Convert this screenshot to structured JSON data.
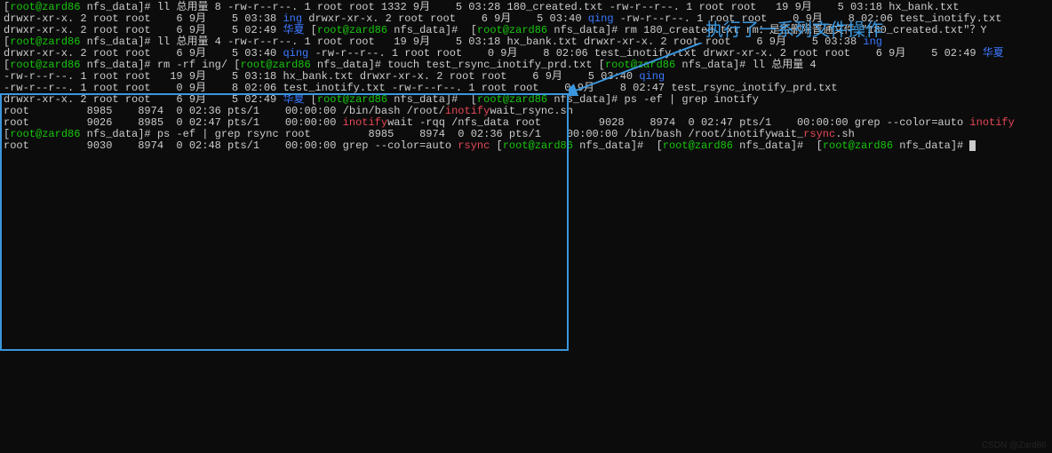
{
  "annotation": "执行了一系列文件操作",
  "watermark": "CSDN @Zard86",
  "prompts": {
    "userhost": "root@zard86",
    "path": "nfs_data"
  },
  "block1": {
    "cmd": "ll",
    "total": "总用量 8",
    "rows": [
      {
        "perm": "-rw-r--r--.",
        "links": "1",
        "owner": "root",
        "group": "root",
        "size": "1332",
        "month": "9月",
        "day": "5",
        "time": "03:28",
        "fname": "180_created.txt",
        "type": "file"
      },
      {
        "perm": "-rw-r--r--.",
        "links": "1",
        "owner": "root",
        "group": "root",
        "size": "19",
        "month": "9月",
        "day": "5",
        "time": "03:18",
        "fname": "hx_bank.txt",
        "type": "file"
      },
      {
        "perm": "drwxr-xr-x.",
        "links": "2",
        "owner": "root",
        "group": "root",
        "size": "6",
        "month": "9月",
        "day": "5",
        "time": "03:38",
        "fname": "ing",
        "type": "dir"
      },
      {
        "perm": "drwxr-xr-x.",
        "links": "2",
        "owner": "root",
        "group": "root",
        "size": "6",
        "month": "9月",
        "day": "5",
        "time": "03:40",
        "fname": "qing",
        "type": "dir"
      },
      {
        "perm": "-rw-r--r--.",
        "links": "1",
        "owner": "root",
        "group": "root",
        "size": "0",
        "month": "9月",
        "day": "8",
        "time": "02:06",
        "fname": "test_inotify.txt",
        "type": "file"
      },
      {
        "perm": "drwxr-xr-x.",
        "links": "2",
        "owner": "root",
        "group": "root",
        "size": "6",
        "month": "9月",
        "day": "5",
        "time": "02:49",
        "fname": "华夏",
        "type": "dir"
      }
    ]
  },
  "block2": {
    "emptycmd": "",
    "rmcmd": "rm 180_created.txt",
    "rmprompt": "rm：是否删除普通文件 \"180_created.txt\"？Y",
    "llcmd": "ll",
    "total": "总用量 4",
    "rows": [
      {
        "perm": "-rw-r--r--.",
        "links": "1",
        "owner": "root",
        "group": "root",
        "size": "19",
        "month": "9月",
        "day": "5",
        "time": "03:18",
        "fname": "hx_bank.txt",
        "type": "file"
      },
      {
        "perm": "drwxr-xr-x.",
        "links": "2",
        "owner": "root",
        "group": "root",
        "size": "6",
        "month": "9月",
        "day": "5",
        "time": "03:38",
        "fname": "ing",
        "type": "dir"
      },
      {
        "perm": "drwxr-xr-x.",
        "links": "2",
        "owner": "root",
        "group": "root",
        "size": "6",
        "month": "9月",
        "day": "5",
        "time": "03:40",
        "fname": "qing",
        "type": "dir"
      },
      {
        "perm": "-rw-r--r--.",
        "links": "1",
        "owner": "root",
        "group": "root",
        "size": "0",
        "month": "9月",
        "day": "8",
        "time": "02:06",
        "fname": "test_inotify.txt",
        "type": "file"
      },
      {
        "perm": "drwxr-xr-x.",
        "links": "2",
        "owner": "root",
        "group": "root",
        "size": "6",
        "month": "9月",
        "day": "5",
        "time": "02:49",
        "fname": "华夏",
        "type": "dir"
      }
    ],
    "rmrf": "rm -rf ing/",
    "touch": "touch test_rsync_inotify_prd.txt",
    "llcmd2": "ll",
    "total2": "总用量 4",
    "rows2": [
      {
        "perm": "-rw-r--r--.",
        "links": "1",
        "owner": "root",
        "group": "root",
        "size": "19",
        "month": "9月",
        "day": "5",
        "time": "03:18",
        "fname": "hx_bank.txt",
        "type": "file"
      },
      {
        "perm": "drwxr-xr-x.",
        "links": "2",
        "owner": "root",
        "group": "root",
        "size": "6",
        "month": "9月",
        "day": "5",
        "time": "03:40",
        "fname": "qing",
        "type": "dir"
      },
      {
        "perm": "-rw-r--r--.",
        "links": "1",
        "owner": "root",
        "group": "root",
        "size": "0",
        "month": "9月",
        "day": "8",
        "time": "02:06",
        "fname": "test_inotify.txt",
        "type": "file"
      },
      {
        "perm": "-rw-r--r--.",
        "links": "1",
        "owner": "root",
        "group": "root",
        "size": "0",
        "month": "9月",
        "day": "8",
        "time": "02:47",
        "fname": "test_rsync_inotify_prd.txt",
        "type": "file"
      },
      {
        "perm": "drwxr-xr-x.",
        "links": "2",
        "owner": "root",
        "group": "root",
        "size": "6",
        "month": "9月",
        "day": "5",
        "time": "02:49",
        "fname": "华夏",
        "type": "dir"
      }
    ]
  },
  "block3": {
    "emptycmd": "",
    "ps1": "ps -ef | grep inotify",
    "psrows1": [
      {
        "user": "root",
        "pid": "8985",
        "ppid": "8974",
        "c": "0",
        "stime": "02:36",
        "tty": "pts/1",
        "time": "00:00:00",
        "cmd_pre": "/bin/bash /root/",
        "cmd_hl": "inotify",
        "cmd_post": "wait_rsync.sh"
      },
      {
        "user": "root",
        "pid": "9026",
        "ppid": "8985",
        "c": "0",
        "stime": "02:47",
        "tty": "pts/1",
        "time": "00:00:00",
        "cmd_pre": "",
        "cmd_hl": "inotify",
        "cmd_post": "wait -rqq /nfs_data"
      },
      {
        "user": "root",
        "pid": "9028",
        "ppid": "8974",
        "c": "0",
        "stime": "02:47",
        "tty": "pts/1",
        "time": "00:00:00",
        "cmd_pre": "grep --color=auto ",
        "cmd_hl": "inotify",
        "cmd_post": ""
      }
    ],
    "ps2": "ps -ef | grep rsync",
    "psrows2": [
      {
        "user": "root",
        "pid": "8985",
        "ppid": "8974",
        "c": "0",
        "stime": "02:36",
        "tty": "pts/1",
        "time": "00:00:00",
        "cmd_pre": "/bin/bash /root/inotifywait_",
        "cmd_hl": "rsync",
        "cmd_post": ".sh"
      },
      {
        "user": "root",
        "pid": "9030",
        "ppid": "8974",
        "c": "0",
        "stime": "02:48",
        "tty": "pts/1",
        "time": "00:00:00",
        "cmd_pre": "grep --color=auto ",
        "cmd_hl": "rsync",
        "cmd_post": ""
      }
    ]
  }
}
